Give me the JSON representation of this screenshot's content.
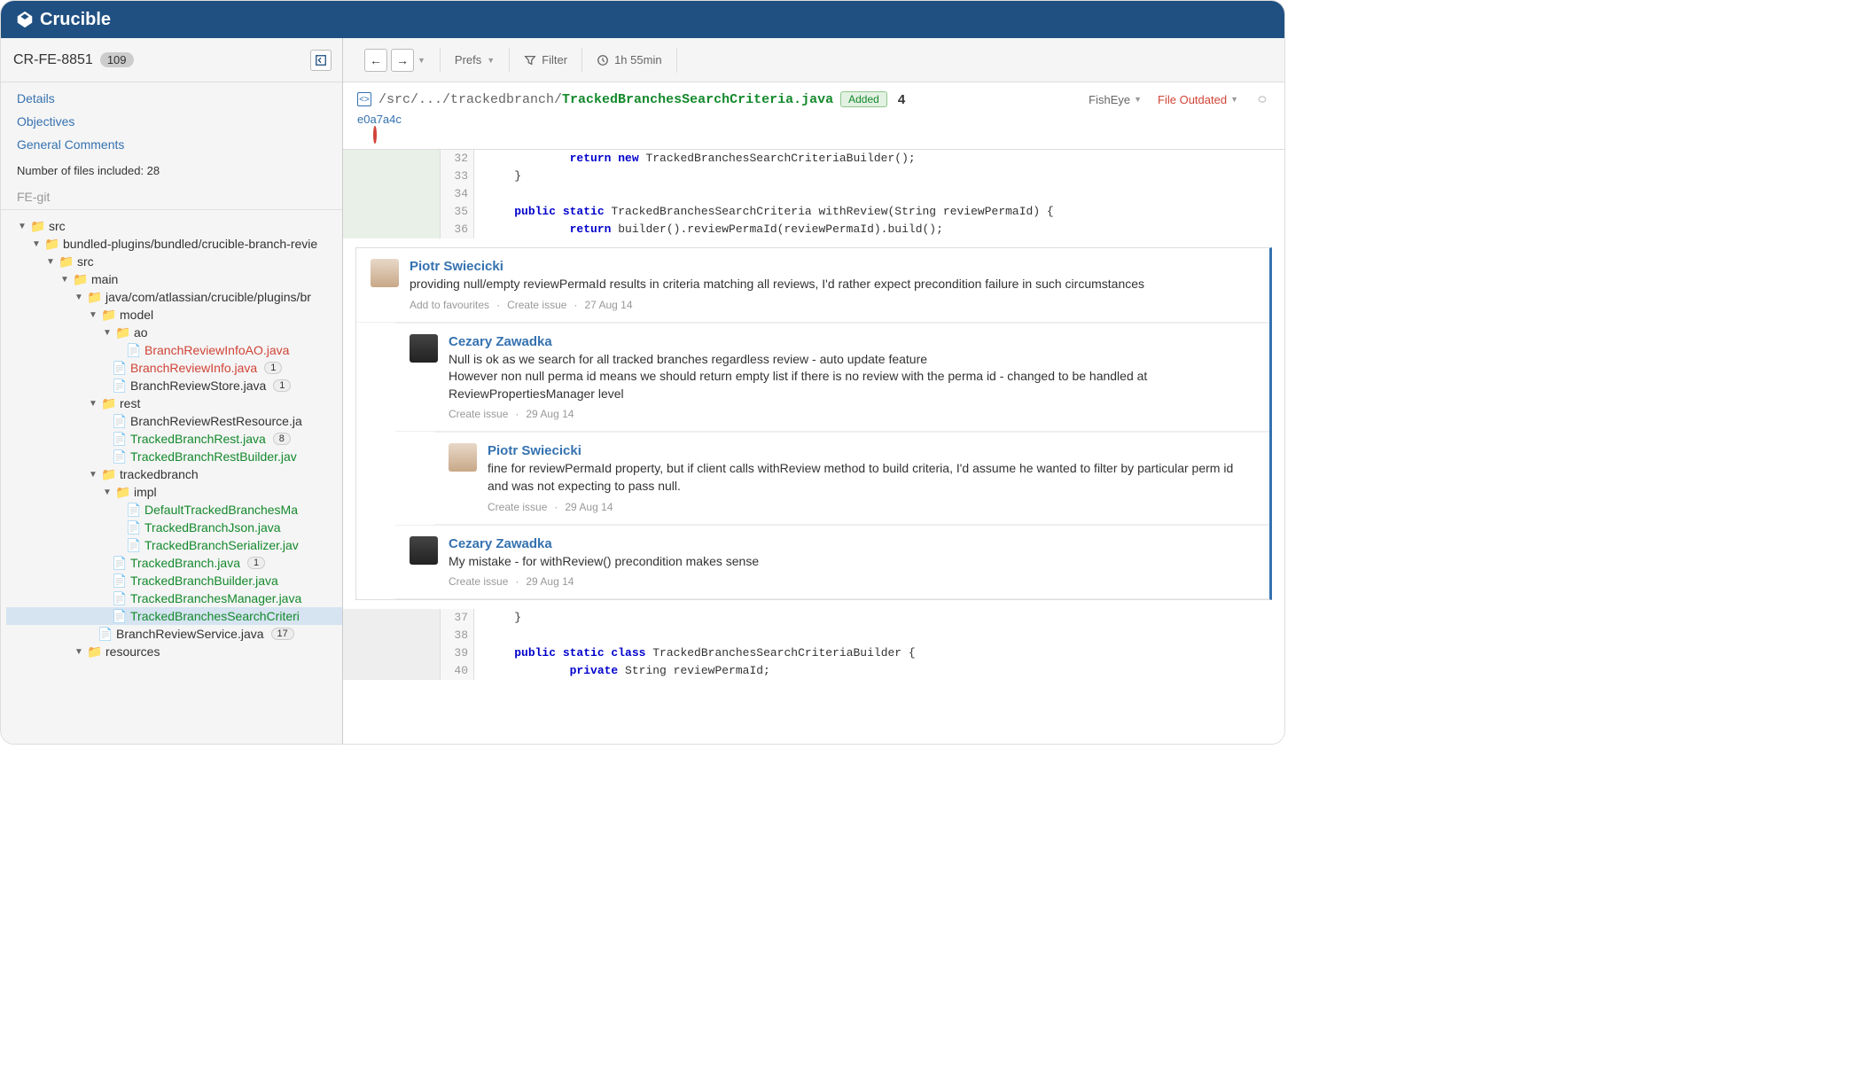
{
  "app_name": "Crucible",
  "review": {
    "id": "CR-FE-8851",
    "file_count_badge": "109"
  },
  "sidebar_links": {
    "details": "Details",
    "objectives": "Objectives",
    "general": "General Comments"
  },
  "sidebar_meta": "Number of files included: 28",
  "repo_label": "FE-git",
  "tree": {
    "src": "src",
    "bundled": "bundled-plugins/bundled/crucible-branch-revie",
    "src2": "src",
    "main": "main",
    "javapath": "java/com/atlassian/crucible/plugins/br",
    "model": "model",
    "ao": "ao",
    "f_ao1": "BranchReviewInfoAO.java",
    "f_bri": "BranchReviewInfo.java",
    "f_bri_c": "1",
    "f_brs": "BranchReviewStore.java",
    "f_brs_c": "1",
    "rest": "rest",
    "f_brr": "BranchReviewRestResource.ja",
    "f_tbr": "TrackedBranchRest.java",
    "f_tbr_c": "8",
    "f_tbrb": "TrackedBranchRestBuilder.jav",
    "tracked": "trackedbranch",
    "impl": "impl",
    "f_dtbm": "DefaultTrackedBranchesMa",
    "f_tbj": "TrackedBranchJson.java",
    "f_tbs": "TrackedBranchSerializer.jav",
    "f_tb": "TrackedBranch.java",
    "f_tb_c": "1",
    "f_tbb": "TrackedBranchBuilder.java",
    "f_tbm": "TrackedBranchesManager.java",
    "f_tbsc": "TrackedBranchesSearchCriteri",
    "f_brsvc": "BranchReviewService.java",
    "f_brsvc_c": "17",
    "resources": "resources"
  },
  "toolbar": {
    "prefs": "Prefs",
    "filter": "Filter",
    "time": "1h 55min"
  },
  "file": {
    "path_prefix": "/src/.../trackedbranch/",
    "path_name": "TrackedBranchesSearchCriteria.java",
    "tag": "Added",
    "comment_count": "4",
    "fisheye": "FishEye",
    "outdated": "File Outdated",
    "commit": "e0a7a4c"
  },
  "code": {
    "l32": "            return new TrackedBranchesSearchCriteriaBuilder();",
    "l33": "    }",
    "l34": "",
    "l35": "    public static TrackedBranchesSearchCriteria withReview(String reviewPermaId) {",
    "l36": "            return builder().reviewPermaId(reviewPermaId).build();",
    "l37": "    }",
    "l38": "",
    "l39": "    public static class TrackedBranchesSearchCriteriaBuilder {",
    "l40": "            private String reviewPermaId;"
  },
  "ln": {
    "l32": "32",
    "l33": "33",
    "l34": "34",
    "l35": "35",
    "l36": "36",
    "l37": "37",
    "l38": "38",
    "l39": "39",
    "l40": "40"
  },
  "comments": {
    "c1": {
      "author": "Piotr Swiecicki",
      "text": "providing null/empty reviewPermaId results in criteria matching all reviews, I'd rather expect precondition failure in such circumstances",
      "fav": "Add to favourites",
      "issue": "Create issue",
      "date": "27 Aug 14"
    },
    "c2": {
      "author": "Cezary Zawadka",
      "text1": "Null is ok as we search for all tracked branches regardless review - auto update feature",
      "text2": "However non null perma id means we should return empty list if there is no review with the perma id - changed to be handled at ReviewPropertiesManager level",
      "issue": "Create issue",
      "date": "29 Aug 14"
    },
    "c3": {
      "author": "Piotr Swiecicki",
      "text": "fine for reviewPermaId property, but if client calls withReview method to build criteria, I'd assume he wanted to filter by particular perm id and was not expecting to pass null.",
      "issue": "Create issue",
      "date": "29 Aug 14"
    },
    "c4": {
      "author": "Cezary Zawadka",
      "text": "My mistake - for withReview() precondition makes sense",
      "issue": "Create issue",
      "date": "29 Aug 14"
    }
  }
}
